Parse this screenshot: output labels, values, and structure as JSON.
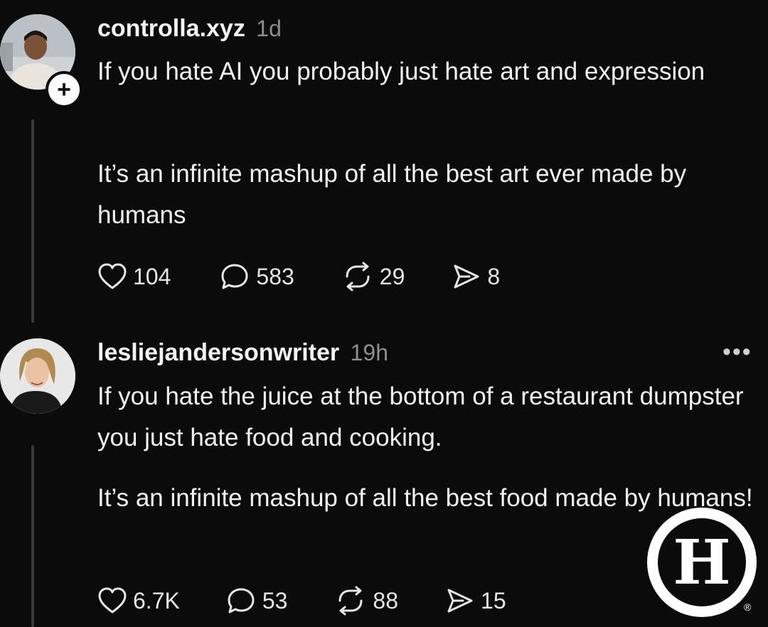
{
  "posts": [
    {
      "username": "controlla.xyz",
      "time": "1d",
      "paragraphs": [
        "If you hate AI you probably just hate art and expression",
        "It’s an infinite mashup of all the best art ever made by humans"
      ],
      "likes": "104",
      "comments": "583",
      "reposts": "29",
      "shares": "8",
      "follow_symbol": "+"
    },
    {
      "username": "lesliejandersonwriter",
      "time": "19h",
      "paragraphs": [
        "If you hate the juice at the bottom of a restaurant dumpster you just hate food and cooking.",
        "It’s an infinite mashup of all the best food made by humans!"
      ],
      "likes": "6.7K",
      "comments": "53",
      "reposts": "88",
      "shares": "15",
      "more_symbol": "•••"
    }
  ],
  "watermark": {
    "letter": "H",
    "registered": "®"
  },
  "icons": [
    "heart-icon",
    "comment-icon",
    "repost-icon",
    "share-icon",
    "plus-icon",
    "more-icon"
  ],
  "colors": {
    "background": "#0b0b0b",
    "text": "#f2f2f2",
    "muted": "#8e8e8e"
  }
}
